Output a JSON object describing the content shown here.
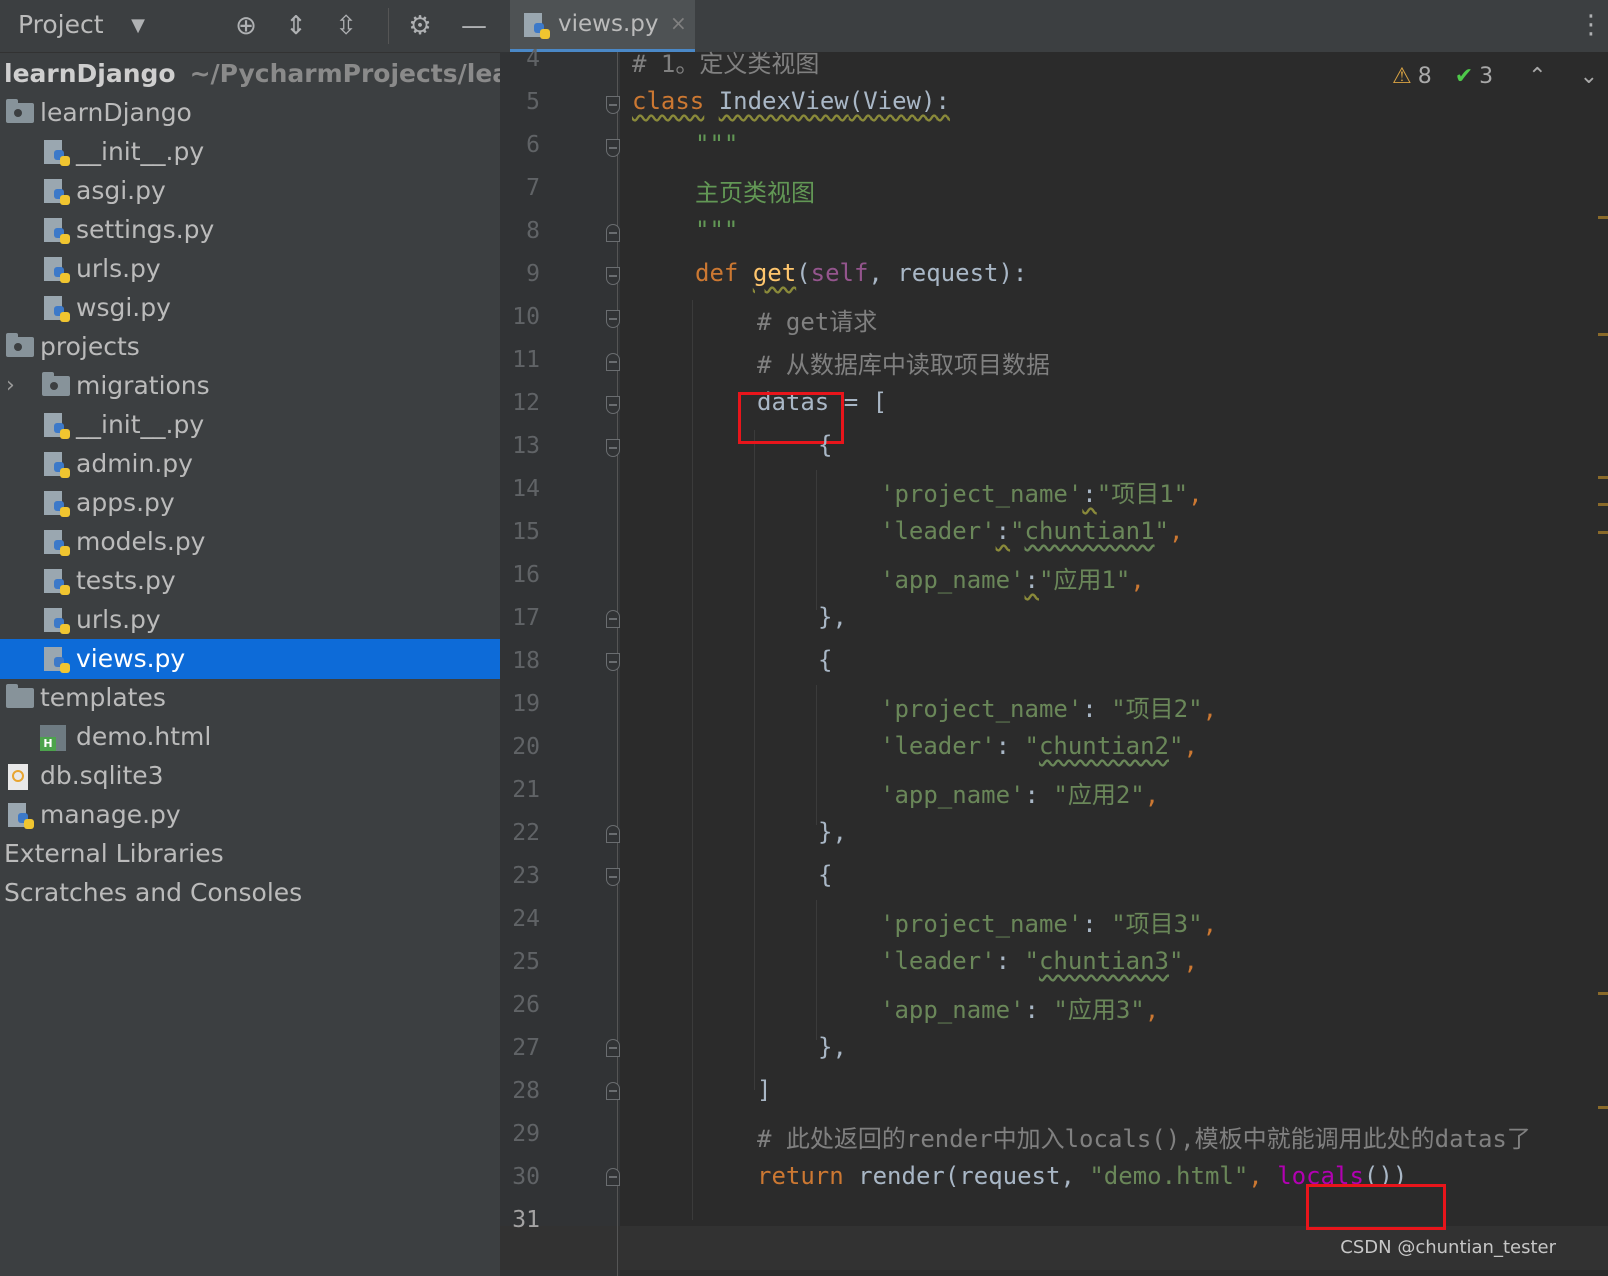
{
  "sidebar": {
    "title": "Project",
    "root": {
      "label": "learnDjango",
      "path": "~/PycharmProjects/learnD"
    },
    "items": [
      {
        "label": "learnDjango"
      },
      {
        "label": "__init__.py"
      },
      {
        "label": "asgi.py"
      },
      {
        "label": "settings.py"
      },
      {
        "label": "urls.py"
      },
      {
        "label": "wsgi.py"
      },
      {
        "label": "projects"
      },
      {
        "label": "migrations"
      },
      {
        "label": "__init__.py"
      },
      {
        "label": "admin.py"
      },
      {
        "label": "apps.py"
      },
      {
        "label": "models.py"
      },
      {
        "label": "tests.py"
      },
      {
        "label": "urls.py"
      },
      {
        "label": "views.py"
      },
      {
        "label": "templates"
      },
      {
        "label": "demo.html"
      },
      {
        "label": "db.sqlite3"
      },
      {
        "label": "manage.py"
      },
      {
        "label": "External Libraries"
      },
      {
        "label": "Scratches and Consoles"
      }
    ]
  },
  "editor": {
    "tab": {
      "label": "views.py",
      "close": "×"
    },
    "inspections": {
      "warnings": "8",
      "ok": "3"
    },
    "line_numbers": [
      "4",
      "5",
      "6",
      "7",
      "8",
      "9",
      "10",
      "11",
      "12",
      "13",
      "14",
      "15",
      "16",
      "17",
      "18",
      "19",
      "20",
      "21",
      "22",
      "23",
      "24",
      "25",
      "26",
      "27",
      "28",
      "29",
      "30",
      "31"
    ],
    "code": {
      "l4": "# 1。定义类视图",
      "l5_kw": "class",
      "l5_name": "IndexView",
      "l5_rest": "(View):",
      "l6": "\"\"\"",
      "l7": "主页类视图",
      "l8": "\"\"\"",
      "l9_kw": "def",
      "l9_fn": "get",
      "l9_p1": "(",
      "l9_self": "self",
      "l9_p2": ", request):",
      "l10": "# get请求",
      "l11": "# 从数据库中读取项目数据",
      "l12_var": "datas",
      "l12_rest": " = [",
      "l13": "{",
      "l14_k": "'project_name'",
      "l14_c": ":",
      "l14_v": "\"项目1\"",
      "l14_e": ",",
      "l15_k": "'leader'",
      "l15_c": ":",
      "l15_v1": "\"",
      "l15_v": "chuntian1",
      "l15_v2": "\"",
      "l15_e": ",",
      "l16_k": "'app_name'",
      "l16_c": ":",
      "l16_v": "\"应用1\"",
      "l16_e": ",",
      "l17": "},",
      "l18": "{",
      "l19_k": "'project_name'",
      "l19_c": ": ",
      "l19_v": "\"项目2\"",
      "l19_e": ",",
      "l20_k": "'leader'",
      "l20_c": ": ",
      "l20_v1": "\"",
      "l20_v": "chuntian2",
      "l20_v2": "\"",
      "l20_e": ",",
      "l21_k": "'app_name'",
      "l21_c": ": ",
      "l21_v": "\"应用2\"",
      "l21_e": ",",
      "l22": "},",
      "l23": "{",
      "l24_k": "'project_name'",
      "l24_c": ": ",
      "l24_v": "\"项目3\"",
      "l24_e": ",",
      "l25_k": "'leader'",
      "l25_c": ": ",
      "l25_v1": "\"",
      "l25_v": "chuntian3",
      "l25_v2": "\"",
      "l25_e": ",",
      "l26_k": "'app_name'",
      "l26_c": ": ",
      "l26_v": "\"应用3\"",
      "l26_e": ",",
      "l27": "},",
      "l28": "]",
      "l29": "# 此处返回的render中加入locals(),模板中就能调用此处的datas了",
      "l30_kw": "return",
      "l30_mid": " render(request, ",
      "l30_str": "\"demo.html\"",
      "l30_comma": ", ",
      "l30_locals": "locals",
      "l30_paren": "()",
      "l30_end": ")"
    }
  },
  "watermark": "CSDN @chuntian_tester",
  "colors": {
    "selection": "#0d6bd8",
    "highlight_box": "#e8151b",
    "keyword": "#cc7832",
    "string": "#6a8759"
  }
}
